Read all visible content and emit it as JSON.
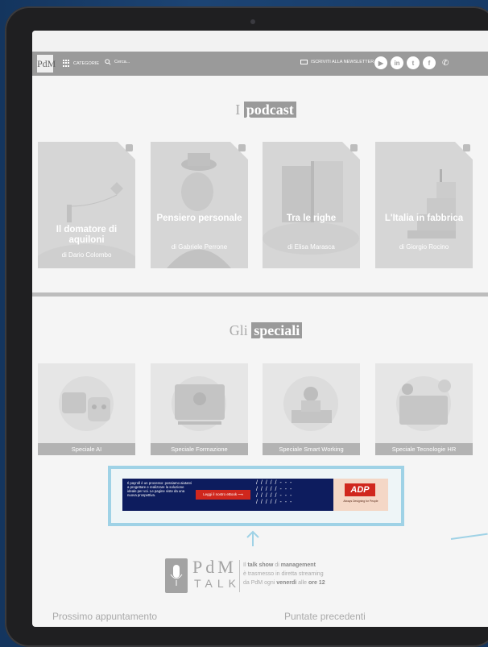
{
  "header": {
    "logo": "PdM",
    "categories": "CATEGORIE",
    "search_placeholder": "Cerca...",
    "newsletter": "ISCRIVITI ALLA NEWSLETTER"
  },
  "podcasts": {
    "title_pre": "I",
    "title_hl": "podcast",
    "items": [
      {
        "title": "Il domatore di aquiloni",
        "author": "di Dario Colombo"
      },
      {
        "title": "Pensiero personale",
        "author": "di Gabriele Perrone"
      },
      {
        "title": "Tra le righe",
        "author": "di Elisa Marasca"
      },
      {
        "title": "L'Italia in fabbrica",
        "author": "di Giorgio Rocino"
      }
    ]
  },
  "specials": {
    "title_pre": "Gli",
    "title_hl": "speciali",
    "items": [
      "Speciale AI",
      "Speciale Formazione",
      "Speciale Smart Working",
      "Speciale Tecnologie HR"
    ]
  },
  "banner": {
    "text": "Il payroll è un processo: possiamo aiutarvi a progettare e realizzare la soluzione ideale per voi. Le pagine viste da una nuova prospettiva.",
    "button": "Leggi il nostro eBook ⟶",
    "brand": "ADP",
    "tagline": "Always Designing for People"
  },
  "talk": {
    "brand": "PdM",
    "word": "TALK",
    "line1a": "Il",
    "line1b": "talk show",
    "line1c": "di",
    "line1d": "management",
    "line2": "è trasmesso in diretta streaming",
    "line3a": "da PdM ogni",
    "line3b": "venerdì",
    "line3c": "alle",
    "line3d": "ore 12"
  },
  "footer": {
    "next": "Prossimo appuntamento",
    "previous": "Puntate precedenti"
  },
  "colors": {
    "accent": "#9fd2e6",
    "header": "#9a9a9a",
    "device_bg": "#14355e"
  }
}
